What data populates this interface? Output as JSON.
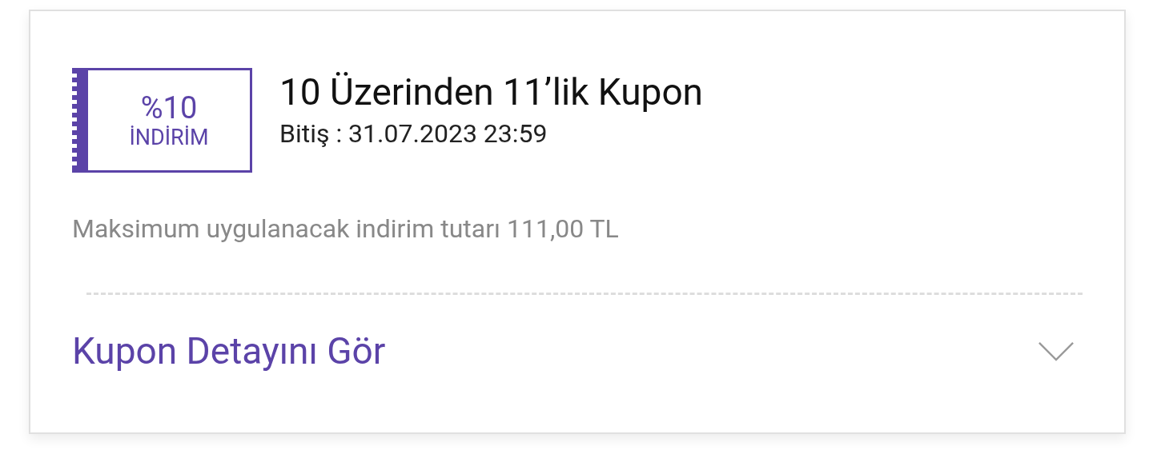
{
  "coupon": {
    "badge": {
      "amount": "%10",
      "label": "İNDİRİM"
    },
    "title": "10 Üzerinden 11’lik Kupon",
    "expiry": "Bitiş : 31.07.2023 23:59",
    "max_discount": "Maksimum uygulanacak indirim tutarı 111,00 TL",
    "details_link": {
      "label": "Kupon Detayını Gör",
      "expanded": false
    }
  }
}
